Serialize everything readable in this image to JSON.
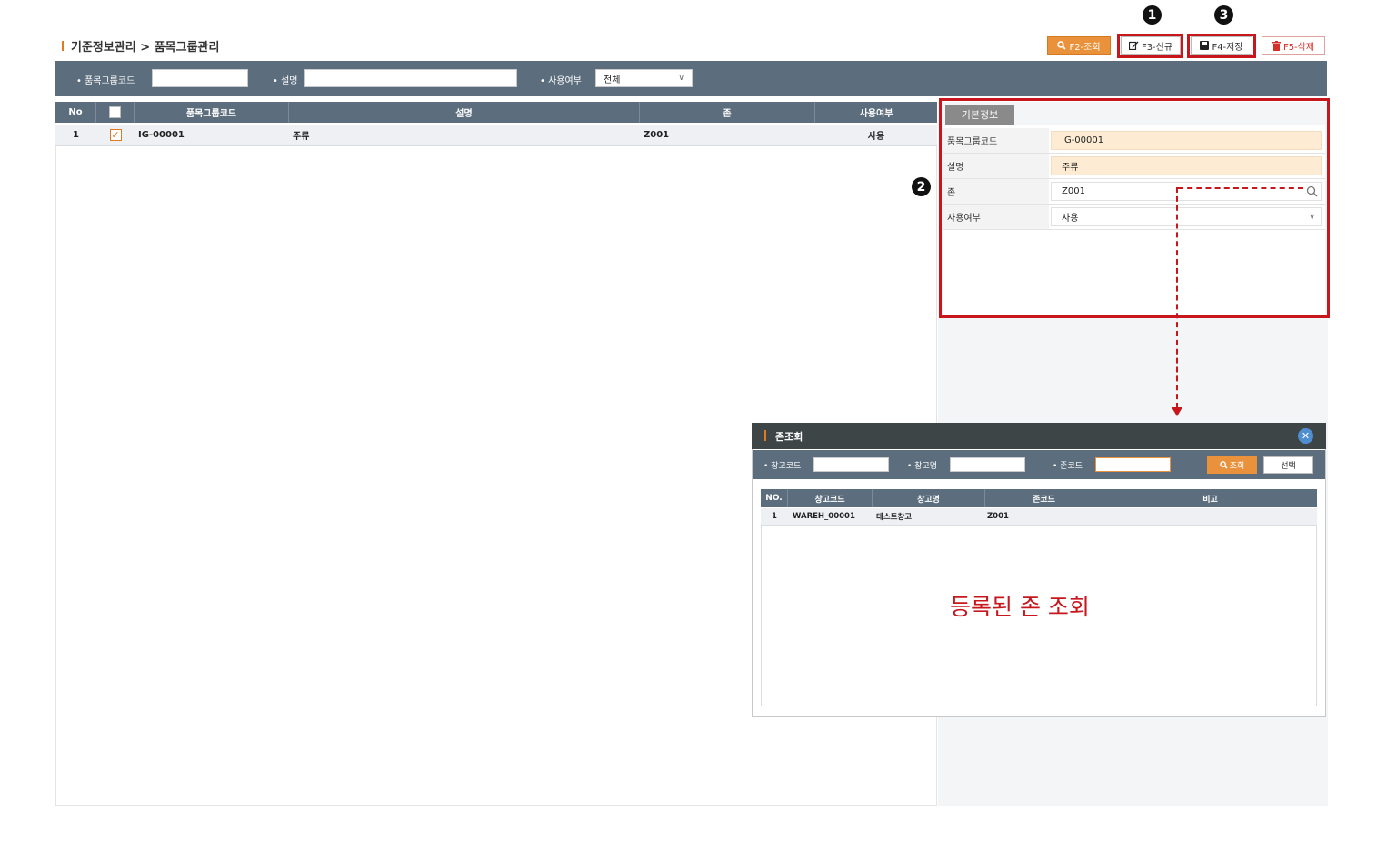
{
  "page": {
    "title": "기준정보관리 > 품목그룹관리"
  },
  "toolbar": {
    "search_label": "F2-조회",
    "new_label": "F3-신규",
    "save_label": "F4-저장",
    "delete_label": "F5-삭제"
  },
  "annotations": {
    "step1": "1",
    "step2": "2",
    "step3": "3",
    "note": "등록된 존 조회",
    "accent_color": "#c8161d"
  },
  "search": {
    "group_code_label": "• 품목그룹코드",
    "group_code_value": "",
    "desc_label": "• 설명",
    "desc_value": "",
    "use_label": "• 사용여부",
    "use_value": "전체"
  },
  "grid": {
    "columns": [
      "No",
      "",
      "품목그룹코드",
      "설명",
      "존",
      "사용여부"
    ],
    "rows": [
      {
        "no": "1",
        "checked": true,
        "code": "IG-00001",
        "desc": "주류",
        "zone": "Z001",
        "use": "사용"
      }
    ]
  },
  "detail": {
    "tab_label": "기본정보",
    "fields": [
      {
        "label": "품목그룹코드",
        "value": "IG-00001"
      },
      {
        "label": "설명",
        "value": "주류"
      },
      {
        "label": "존",
        "value": "Z001"
      },
      {
        "label": "사용여부",
        "value": "사용"
      }
    ]
  },
  "popup": {
    "title": "존조회",
    "warehouse_code_label": "• 창고코드",
    "warehouse_name_label": "• 창고명",
    "zone_code_label": "• 존코드",
    "search_button": "조회",
    "select_button": "선택",
    "columns": [
      "NO.",
      "창고코드",
      "창고명",
      "존코드",
      "비고"
    ],
    "rows": [
      {
        "no": "1",
        "wh_code": "WAREH_00001",
        "wh_name": "테스트창고",
        "zone_code": "Z001",
        "note": ""
      }
    ]
  },
  "colors": {
    "header_bg": "#5c6d7d",
    "search_button_bg": "#e9913b",
    "required_bg": "#fdecd3"
  }
}
